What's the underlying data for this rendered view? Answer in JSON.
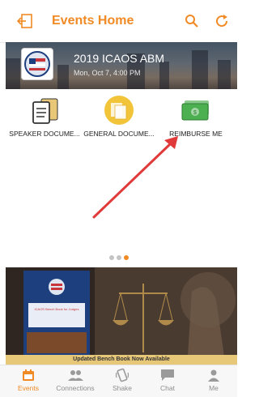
{
  "header": {
    "title": "Events Home"
  },
  "event": {
    "name": "2019 ICAOS ABM",
    "date": "Mon, Oct 7, 4:00 PM"
  },
  "tiles": [
    {
      "label": "SPEAKER DOCUME..."
    },
    {
      "label": "GENERAL DOCUME..."
    },
    {
      "label": "REIMBURSE ME"
    }
  ],
  "carousel": {
    "page_count": 3,
    "active_index": 2
  },
  "ad": {
    "caption": "Updated Bench Book Now Available",
    "book_title": "ICAOS Bench Book for Judges"
  },
  "tabs": [
    {
      "label": "Events",
      "icon": "calendar-icon",
      "active": true
    },
    {
      "label": "Connections",
      "icon": "people-icon",
      "active": false
    },
    {
      "label": "Shake",
      "icon": "phone-shake-icon",
      "active": false
    },
    {
      "label": "Chat",
      "icon": "chat-icon",
      "active": false
    },
    {
      "label": "Me",
      "icon": "person-icon",
      "active": false
    }
  ],
  "colors": {
    "accent": "#f08a24",
    "annotation_arrow": "#e03a3a"
  }
}
